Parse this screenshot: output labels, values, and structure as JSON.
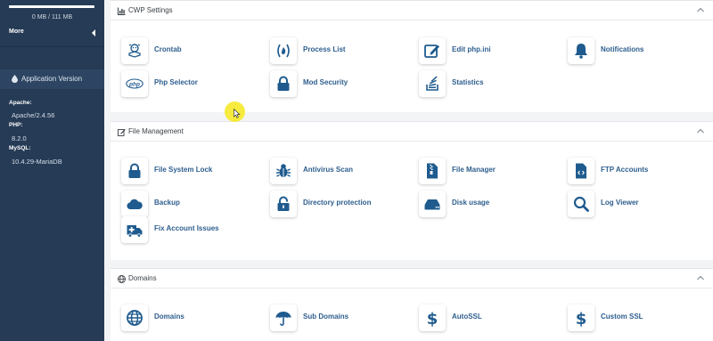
{
  "colors": {
    "sidebar_bg": "#263b55",
    "icon_blue": "#1f5b8e",
    "link_blue": "#2e5e8e",
    "cursor_highlight": "#f5ea34"
  },
  "sidebar": {
    "disk_usage": "0 MB / 111 MB",
    "more_label": "More",
    "app_version_title": "Application Version",
    "info": [
      {
        "label": "Apache:",
        "value": "Apache/2.4.56"
      },
      {
        "label": "PHP:",
        "value": "8.2.0"
      },
      {
        "label": "MySQL:",
        "value": "10.4.29-MariaDB"
      }
    ]
  },
  "sections": [
    {
      "title": "CWP Settings",
      "icon": "bar-chart-icon",
      "items": [
        {
          "label": "Crontab",
          "icon": "crontab-icon"
        },
        {
          "label": "Process List",
          "icon": "process-list-icon"
        },
        {
          "label": "Edit php.ini",
          "icon": "edit-icon"
        },
        {
          "label": "Notifications",
          "icon": "bell-icon"
        },
        {
          "label": "Php Selector",
          "icon": "php-icon"
        },
        {
          "label": "Mod Security",
          "icon": "lock-icon"
        },
        {
          "label": "Statistics",
          "icon": "stack-icon"
        }
      ]
    },
    {
      "title": "File Management",
      "icon": "edit-square-icon",
      "items": [
        {
          "label": "File System Lock",
          "icon": "lock-icon"
        },
        {
          "label": "Antivirus Scan",
          "icon": "bug-icon"
        },
        {
          "label": "File Manager",
          "icon": "file-zip-icon"
        },
        {
          "label": "FTP Accounts",
          "icon": "file-code-icon"
        },
        {
          "label": "Backup",
          "icon": "cloud-icon"
        },
        {
          "label": "Directory protection",
          "icon": "unlock-icon"
        },
        {
          "label": "Disk usage",
          "icon": "hdd-icon"
        },
        {
          "label": "Log Viewer",
          "icon": "search-icon"
        },
        {
          "label": "Fix Account Issues",
          "icon": "ambulance-icon"
        }
      ]
    },
    {
      "title": "Domains",
      "icon": "globe-icon",
      "items": [
        {
          "label": "Domains",
          "icon": "globe-icon"
        },
        {
          "label": "Sub Domains",
          "icon": "umbrella-icon"
        },
        {
          "label": "AutoSSL",
          "icon": "dollar-icon"
        },
        {
          "label": "Custom SSL",
          "icon": "dollar-icon"
        }
      ]
    }
  ]
}
